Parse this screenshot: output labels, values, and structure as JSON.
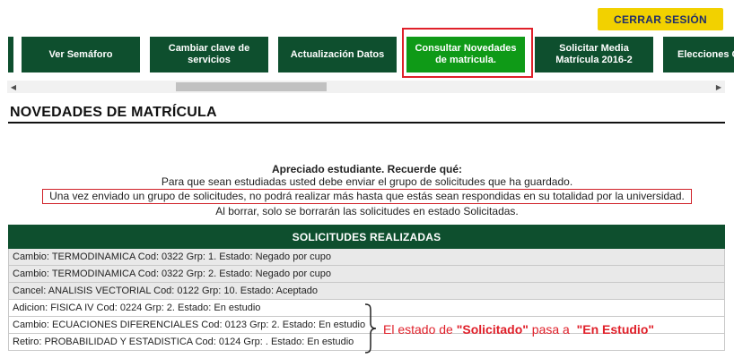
{
  "header": {
    "logout_label": "CERRAR SESIÓN"
  },
  "nav": {
    "items": [
      {
        "label": "Ver Semáforo"
      },
      {
        "label": "Cambiar clave de servicios"
      },
      {
        "label": "Actualización Datos"
      },
      {
        "label": "Consultar Novedades de matricula."
      },
      {
        "label": "Solicitar Media Matrícula 2016-2"
      },
      {
        "label": "Elecciones Colegi"
      }
    ],
    "active_index": 3
  },
  "page": {
    "title": "NOVEDADES DE MATRÍCULA"
  },
  "notice": {
    "heading": "Apreciado estudiante. Recuerde qué:",
    "line1": "Para que sean estudiadas usted debe enviar el grupo de solicitudes que ha guardado.",
    "line2": "Una vez enviado un grupo de solicitudes, no podrá realizar más hasta que estás sean respondidas en su totalidad por la universidad.",
    "line3": "Al borrar, solo se borrarán las solicitudes en estado Solicitadas."
  },
  "requests": {
    "header": "SOLICITUDES REALIZADAS",
    "rows": [
      "Cambio: TERMODINAMICA Cod: 0322 Grp: 1. Estado: Negado por cupo",
      "Cambio: TERMODINAMICA Cod: 0322 Grp: 2. Estado: Negado por cupo",
      "Cancel: ANALISIS VECTORIAL Cod: 0122 Grp: 10. Estado: Aceptado",
      "Adicion: FISICA IV Cod: 0224 Grp: 2. Estado: En estudio",
      "Cambio: ECUACIONES DIFERENCIALES Cod: 0123 Grp: 2. Estado: En estudio",
      "Retiro: PROBABILIDAD Y ESTADISTICA Cod: 0124 Grp: . Estado: En estudio"
    ]
  },
  "annotation": {
    "prefix": "El estado de ",
    "from": "\"Solicitado\"",
    "middle": " pasa a ",
    "to": "\"En Estudio\""
  },
  "colors": {
    "nav_bg": "#0e4f2e",
    "nav_active": "#0f9a17",
    "logout_bg": "#f2d100",
    "highlight": "#e0202a"
  }
}
